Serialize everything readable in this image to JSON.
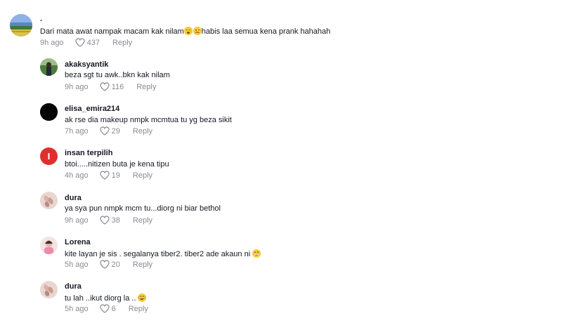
{
  "comments": [
    {
      "username": ".",
      "text": "Dari mata awat nampak macam kak nilam",
      "text_after_emoji": "habis laa semua kena prank hahahah",
      "emoji_icons": [
        "weary-face-icon",
        "woozy-face-icon"
      ],
      "time": "9h ago",
      "likes": "437",
      "reply_label": "Reply",
      "avatar": "landscape-avatar"
    }
  ],
  "replies": [
    {
      "username": "akaksyantik",
      "text": "beza sgt tu awk..bkn kak nilam",
      "time": "9h ago",
      "likes": "116",
      "reply_label": "Reply",
      "avatar": "person-green-avatar"
    },
    {
      "username": "elisa_emira214",
      "text": "ak rse dia makeup nmpk mcmtua tu yg beza sikit",
      "time": "7h ago",
      "likes": "29",
      "reply_label": "Reply",
      "avatar": "black-avatar"
    },
    {
      "username": "insan terpilih",
      "text": "btoi.....nitizen buta je kena tipu",
      "time": "4h ago",
      "likes": "19",
      "reply_label": "Reply",
      "avatar": "red-letter-avatar",
      "avatar_letter": "I"
    },
    {
      "username": "dura",
      "text": "ya sya pun nmpk mcm tu...diorg ni biar bethol",
      "time": "9h ago",
      "likes": "38",
      "reply_label": "Reply",
      "avatar": "nails-avatar"
    },
    {
      "username": "Lorena",
      "text": "kite layan je sis . segalanya tiber2. tiber2 ade akaun ni ",
      "emoji_icons": [
        "grinning-sweat-face-icon"
      ],
      "time": "5h ago",
      "likes": "20",
      "reply_label": "Reply",
      "avatar": "pink-person-avatar"
    },
    {
      "username": "dura",
      "text": "tu lah ..ikut diorg la ..",
      "emoji_icons": [
        "tears-of-joy-face-icon"
      ],
      "time": "5h ago",
      "likes": "6",
      "reply_label": "Reply",
      "avatar": "nails-avatar"
    }
  ],
  "colors": {
    "text": "#161823",
    "meta": "#8a8b91",
    "emoji": "#f7c93a",
    "insan_avatar": "#e0302d"
  }
}
